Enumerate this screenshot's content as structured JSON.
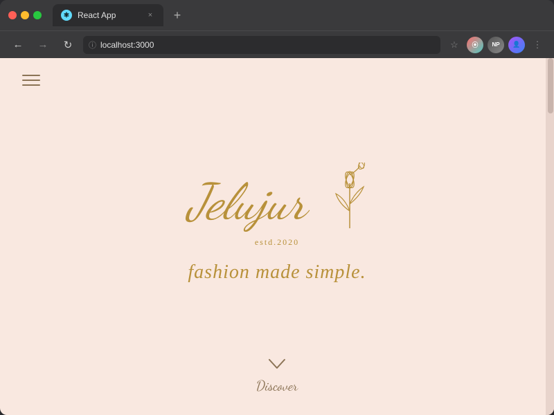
{
  "browser": {
    "title": "React App",
    "tab_close": "×",
    "new_tab": "+",
    "url": "localhost:3000",
    "nav": {
      "back": "←",
      "forward": "→",
      "reload": "↻",
      "favicon_letter": "R",
      "user_initials": "NP",
      "more": "⋮"
    }
  },
  "webpage": {
    "hamburger_lines": 3,
    "logo_text": "Jelujur",
    "estd": "estd.2020",
    "tagline": "fashion made simple.",
    "discover_label": "Discover",
    "chevron": "∨"
  },
  "colors": {
    "background": "#f9e8e0",
    "gold": "#b8913a",
    "dark_gold": "#8b7355"
  }
}
